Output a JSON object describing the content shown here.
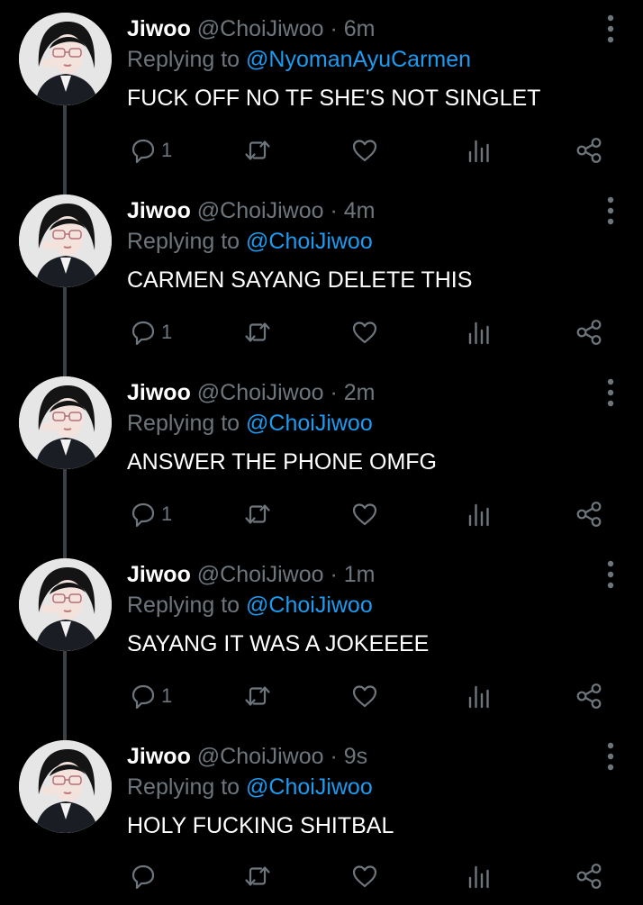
{
  "colors": {
    "background": "#000000",
    "text": "#ffffff",
    "muted": "#6e767d",
    "mention": "#1d9bf0",
    "thread_line": "#3c4043"
  },
  "icons": {
    "reply": "reply-bubble-icon",
    "retweet": "retweet-icon",
    "like": "heart-icon",
    "views": "bar-chart-icon",
    "share": "share-icon",
    "more": "more-vertical-icon"
  },
  "tweets": [
    {
      "display_name": "Jiwoo",
      "handle": "@ChoiJiwoo",
      "separator": "·",
      "time": "6m",
      "replying_to_label": "Replying to",
      "replying_to_handle": "@NyomanAyuCarmen",
      "text": "FUCK OFF NO TF SHE'S NOT SINGLET",
      "reply_count": "1"
    },
    {
      "display_name": "Jiwoo",
      "handle": "@ChoiJiwoo",
      "separator": "·",
      "time": "4m",
      "replying_to_label": "Replying to",
      "replying_to_handle": "@ChoiJiwoo",
      "text": "CARMEN SAYANG DELETE THIS",
      "reply_count": "1"
    },
    {
      "display_name": "Jiwoo",
      "handle": "@ChoiJiwoo",
      "separator": "·",
      "time": "2m",
      "replying_to_label": "Replying to",
      "replying_to_handle": "@ChoiJiwoo",
      "text": "ANSWER THE PHONE OMFG",
      "reply_count": "1"
    },
    {
      "display_name": "Jiwoo",
      "handle": "@ChoiJiwoo",
      "separator": "·",
      "time": "1m",
      "replying_to_label": "Replying to",
      "replying_to_handle": "@ChoiJiwoo",
      "text": "SAYANG IT WAS A JOKEEEE",
      "reply_count": "1"
    },
    {
      "display_name": "Jiwoo",
      "handle": "@ChoiJiwoo",
      "separator": "·",
      "time": "9s",
      "replying_to_label": "Replying to",
      "replying_to_handle": "@ChoiJiwoo",
      "text": "HOLY FUCKING SHITBAL",
      "reply_count": ""
    }
  ]
}
